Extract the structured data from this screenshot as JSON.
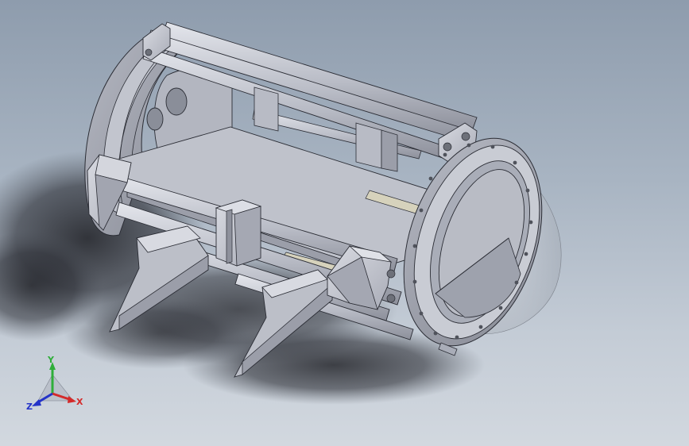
{
  "scene": {
    "background_top": "#8e9cad",
    "background_bottom": "#d2d8df",
    "part_color": "#c8cad3",
    "edge_color": "#2b2d35"
  },
  "triad": {
    "x_label": "X",
    "y_label": "Y",
    "z_label": "Z",
    "x_color": "#d42a2a",
    "y_color": "#2fae3a",
    "z_color": "#2433c8"
  }
}
